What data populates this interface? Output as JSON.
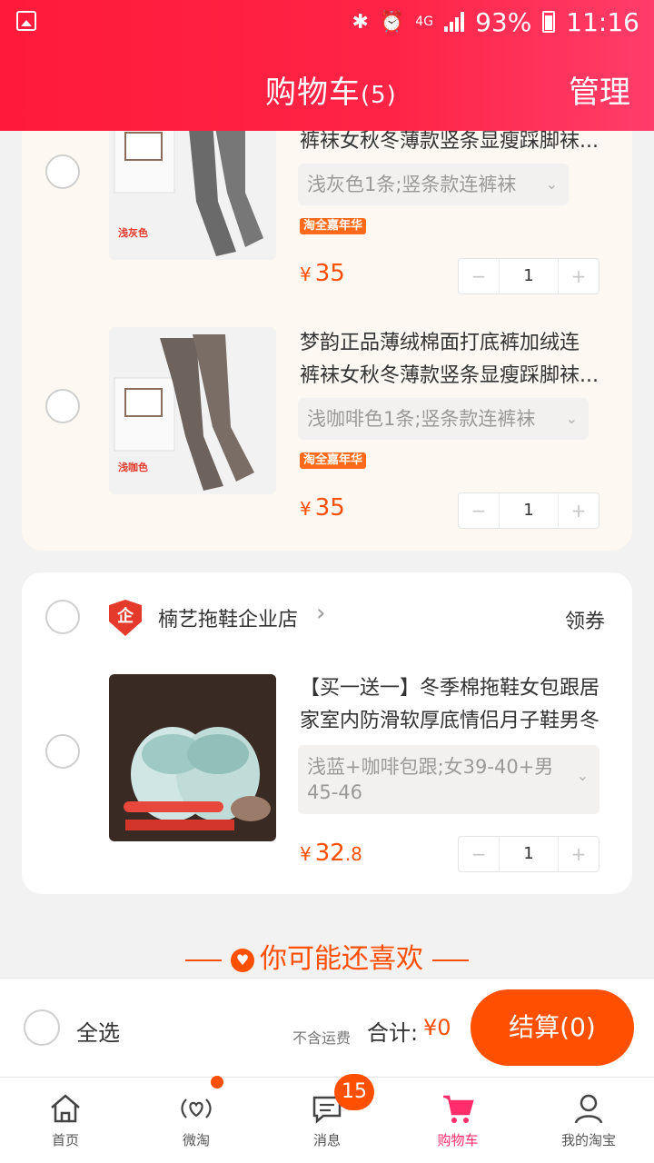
{
  "status_bar": {
    "battery": "93%",
    "time": "11:16",
    "network": "4G"
  },
  "header": {
    "title": "购物车",
    "count": "(5)",
    "manage_label": "管理"
  },
  "cart_group1": {
    "items": [
      {
        "title_line2": "裤袜女秋冬薄款竖条显瘦踩脚袜...",
        "thumb_label": "浅灰色",
        "sku": "浅灰色1条;竖条款连裤袜",
        "promo": "淘全嘉年华",
        "price_symbol": "¥",
        "price": "35",
        "qty": "1"
      },
      {
        "title_line1": "梦韵正品薄绒棉面打底裤加绒连",
        "title_line2": "裤袜女秋冬薄款竖条显瘦踩脚袜...",
        "thumb_label": "浅咖色",
        "sku": "浅咖啡色1条;竖条款连裤袜",
        "promo": "淘全嘉年华",
        "price_symbol": "¥",
        "price": "35",
        "qty": "1"
      }
    ]
  },
  "cart_group2": {
    "shop_name": "楠艺拖鞋企业店",
    "shop_logo_text": "企",
    "coupon_label": "领券",
    "item": {
      "title_line1": "【买一送一】冬季棉拖鞋女包跟居",
      "title_line2": "家室内防滑软厚底情侣月子鞋男冬",
      "sku_line1": "浅蓝+咖啡包跟;女39-40+男",
      "sku_line2": "45-46",
      "price_symbol": "¥",
      "price_int": "32",
      "price_dec": ".8",
      "qty": "1"
    }
  },
  "recommend": {
    "label": "你可能还喜欢"
  },
  "checkout": {
    "select_all": "全选",
    "shipping_note": "不含运费",
    "total_label": "合计:",
    "total_value": "¥0",
    "button_label": "结算(0)"
  },
  "tabs": [
    {
      "label": "首页",
      "icon": "home-icon"
    },
    {
      "label": "微淘",
      "icon": "heart-broadcast-icon"
    },
    {
      "label": "消息",
      "icon": "message-icon"
    },
    {
      "label": "购物车",
      "icon": "cart-icon"
    },
    {
      "label": "我的淘宝",
      "icon": "profile-icon"
    }
  ],
  "message_badge": "15",
  "colors": {
    "brand": "#ff1a3a",
    "accent": "#ff4f00",
    "active_tab": "#ff2d6b"
  }
}
